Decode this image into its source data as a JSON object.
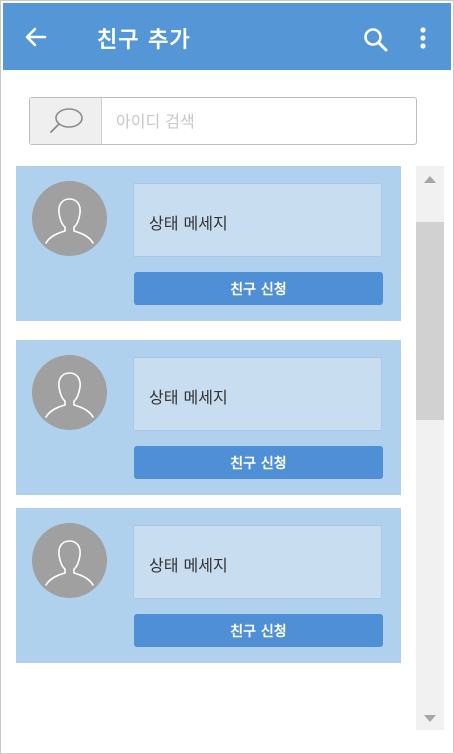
{
  "appbar": {
    "title": "친구 추가",
    "back_icon": "arrow-left-icon",
    "search_icon": "search-icon",
    "more_icon": "more-vertical-icon",
    "color": "#5596d6"
  },
  "search": {
    "placeholder": "아이디 검색",
    "value": "",
    "icon": "speech-bubble-icon"
  },
  "cards": [
    {
      "status": "상태 메세지",
      "button": "친구 신청"
    },
    {
      "status": "상태 메세지",
      "button": "친구 신청"
    },
    {
      "status": "상태 메세지",
      "button": "친구 신청"
    }
  ],
  "colors": {
    "card_bg": "#afd1ee",
    "button_bg": "#4f8fd5",
    "avatar_bg": "#a0a0a0"
  }
}
